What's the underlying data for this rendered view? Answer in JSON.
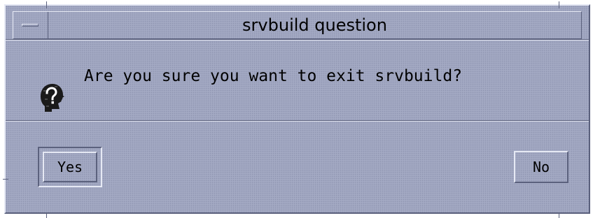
{
  "window": {
    "title": "srvbuild question",
    "menu_icon": "window-menu-icon"
  },
  "message": {
    "icon": "question-icon",
    "text": "Are you sure you want to exit srvbuild?"
  },
  "buttons": {
    "yes_label": "Yes",
    "no_label": "No",
    "default": "Yes"
  },
  "colors": {
    "background": "#a3a9c3",
    "highlight": "#e6e9f4",
    "shadow": "#5b617d",
    "text": "#000000"
  }
}
